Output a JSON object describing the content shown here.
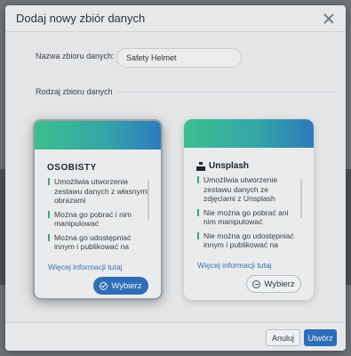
{
  "dialog": {
    "title": "Dodaj nowy zbiór danych",
    "name_label": "Nazwa zbioru danych:",
    "name_value": "Safety Helmet",
    "section_label": "Rodzaj zbioru danych"
  },
  "cards": [
    {
      "title": "OSOBISTY",
      "features": [
        "Umożliwia utworzenie zestawu danych z własnymi obrazami",
        "Można go pobrać i nim manipulować",
        "Można go udostępniać innym i publikować na"
      ],
      "more_link": "Więcej informacji tutaj",
      "button_label": "Wybierz",
      "selected": true
    },
    {
      "title": "Unsplash",
      "features": [
        "Umożliwia utworzenie zestawu danych ze zdjęciami z Unsplash",
        "Nie można go pobrać ani nim manipulować",
        "Nie można go udostępniać innym i publikować na"
      ],
      "more_link": "Więcej informacji tutaj",
      "button_label": "Wybierz",
      "selected": false
    }
  ],
  "footer": {
    "cancel_label": "Anuluj",
    "create_label": "Utwórz"
  },
  "colors": {
    "accent": "#2e6db8",
    "gradient_start": "#3cbf8f",
    "gradient_end": "#2d7bbd"
  }
}
